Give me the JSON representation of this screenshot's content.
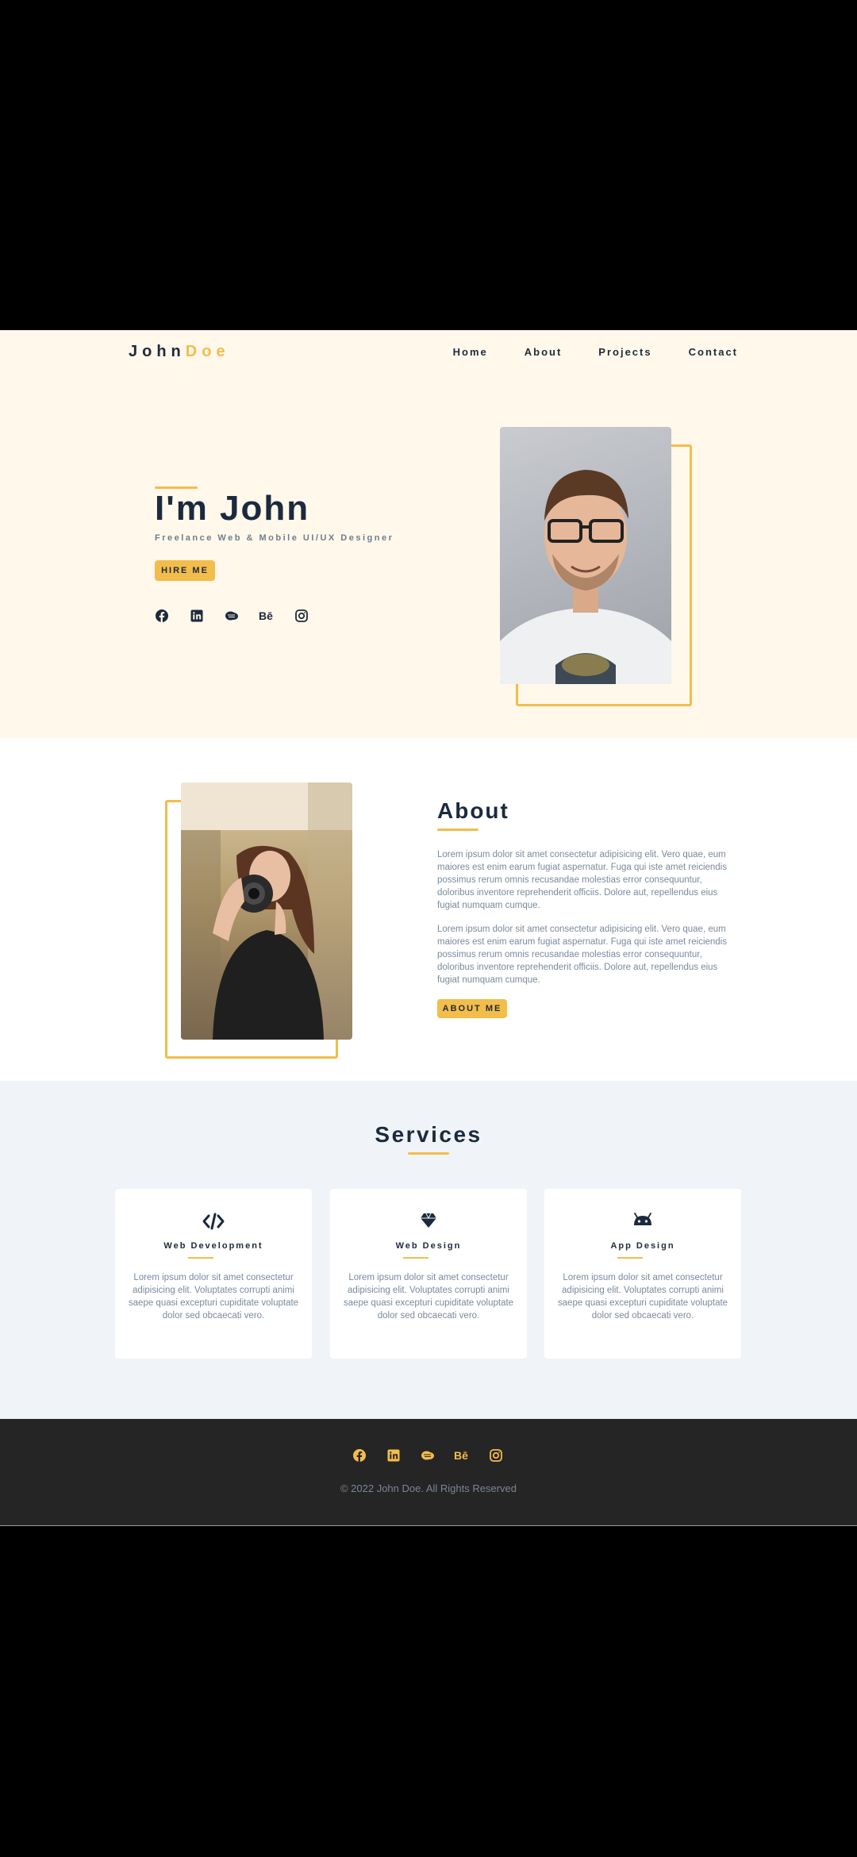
{
  "header": {
    "logo_first": "John",
    "logo_second": "Doe",
    "nav": [
      "Home",
      "About",
      "Projects",
      "Contact"
    ]
  },
  "hero": {
    "title": "I'm John",
    "subtitle": "Freelance Web & Mobile UI/UX Designer",
    "button": "HIRE ME"
  },
  "about": {
    "title": "About",
    "paragraph1": "Lorem ipsum dolor sit amet consectetur adipisicing elit. Vero quae, eum maiores est enim earum fugiat aspernatur. Fuga qui iste amet reiciendis possimus rerum omnis recusandae molestias error consequuntur, doloribus inventore reprehenderit officiis. Dolore aut, repellendus eius fugiat numquam cumque.",
    "paragraph2": "Lorem ipsum dolor sit amet consectetur adipisicing elit. Vero quae, eum maiores est enim earum fugiat aspernatur. Fuga qui iste amet reiciendis possimus rerum omnis recusandae molestias error consequuntur, doloribus inventore reprehenderit officiis. Dolore aut, repellendus eius fugiat numquam cumque.",
    "button": "ABOUT ME"
  },
  "services": {
    "title": "Services",
    "cards": [
      {
        "title": "Web Development",
        "icon": "code-icon",
        "text": "Lorem ipsum dolor sit amet consectetur adipisicing elit. Voluptates corrupti animi saepe quasi excepturi cupiditate voluptate dolor sed obcaecati vero."
      },
      {
        "title": "Web Design",
        "icon": "diamond-icon",
        "text": "Lorem ipsum dolor sit amet consectetur adipisicing elit. Voluptates corrupti animi saepe quasi excepturi cupiditate voluptate dolor sed obcaecati vero."
      },
      {
        "title": "App Design",
        "icon": "android-icon",
        "text": "Lorem ipsum dolor sit amet consectetur adipisicing elit. Voluptates corrupti animi saepe quasi excepturi cupiditate voluptate dolor sed obcaecati vero."
      }
    ]
  },
  "social_icons": [
    "facebook-icon",
    "linkedin-icon",
    "codepen-icon",
    "behance-icon",
    "instagram-icon"
  ],
  "footer": {
    "copyright": "© 2022 John Doe. All Rights Reserved"
  },
  "colors": {
    "accent": "#f2bd4b",
    "heading": "#1b2a3d",
    "hero_bg": "#fff8eb",
    "services_bg": "#f0f3f7",
    "footer_bg": "#252525"
  }
}
